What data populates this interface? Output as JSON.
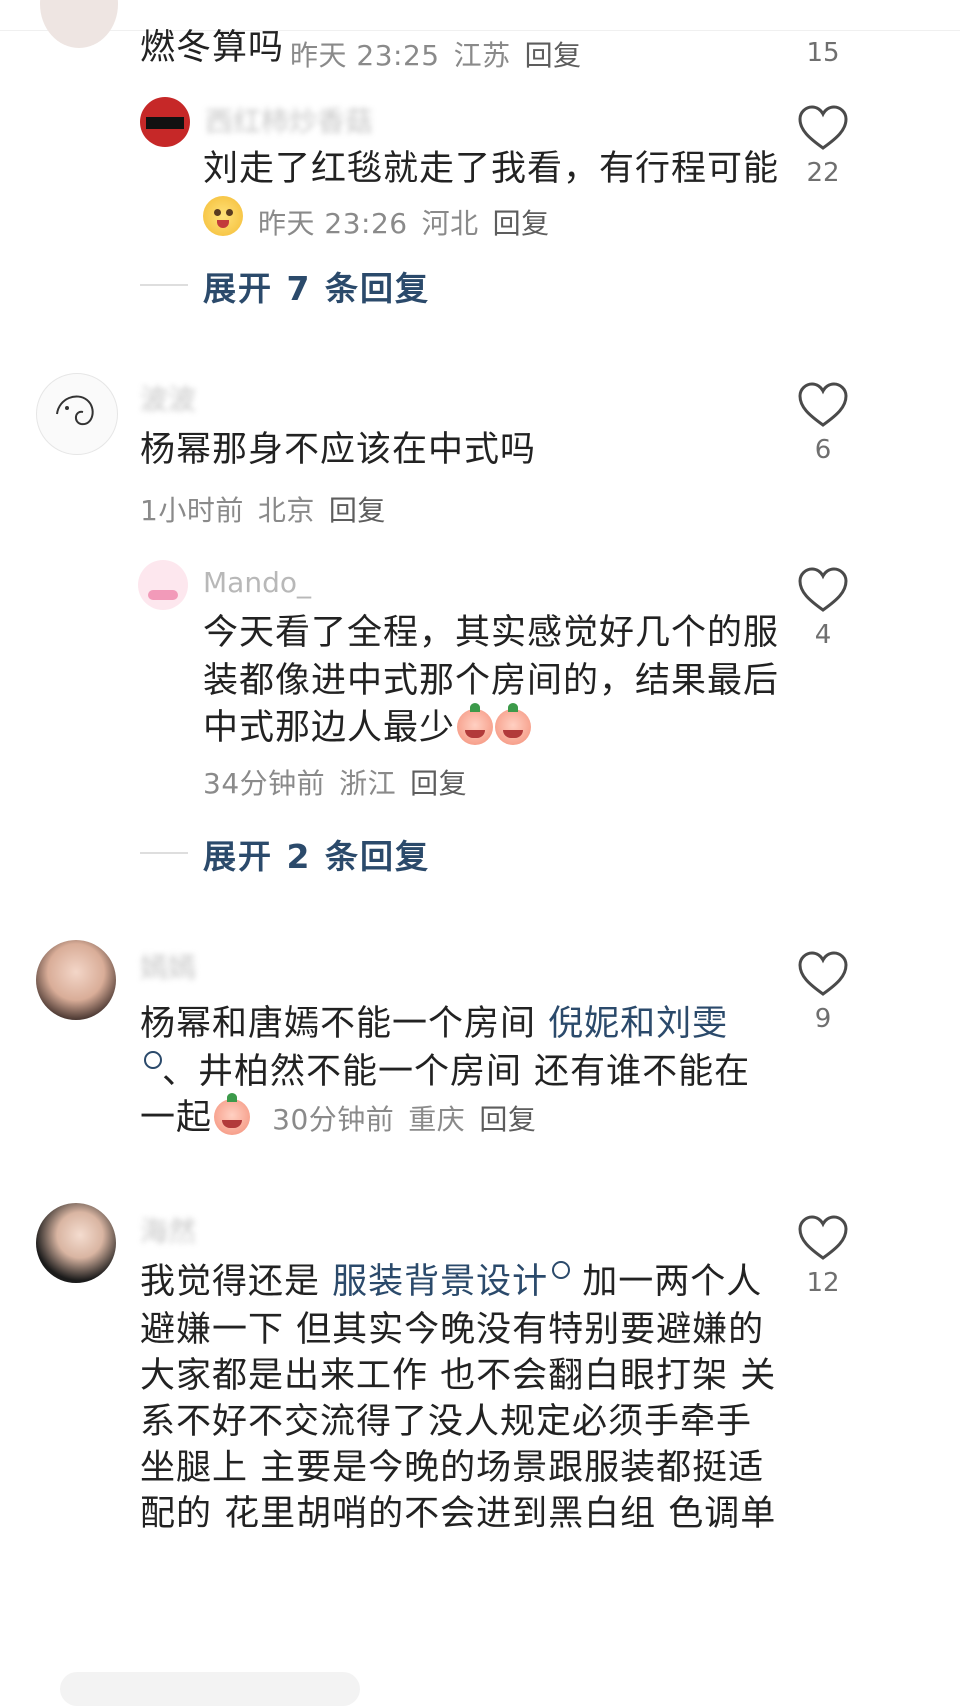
{
  "comments": [
    {
      "text": "燃冬算吗",
      "time": "昨天 23:25",
      "location": "江苏",
      "reply": "回复",
      "likes": "15"
    },
    {
      "name": "西红柿炒香菇",
      "text": "刘走了红毯就走了我看，有行程可能",
      "time": "昨天 23:26",
      "location": "河北",
      "reply": "回复",
      "likes": "22",
      "expand": "展开 7 条回复"
    },
    {
      "name": "波波",
      "text": "杨幂那身不应该在中式吗",
      "time": "1小时前",
      "location": "北京",
      "reply": "回复",
      "likes": "6"
    },
    {
      "name": "Mando_",
      "text_lines": [
        "今天看了全程，其实感觉好几个的服",
        "装都像进中式那个房间的，结果最后",
        "中式那边人最少"
      ],
      "time": "34分钟前",
      "location": "浙江",
      "reply": "回复",
      "likes": "4",
      "expand": "展开 2 条回复"
    },
    {
      "name": "嫣嫣",
      "text_part1": "杨幂和唐嫣不能一个房间 ",
      "link1": "倪妮和刘雯",
      "text_part2": "、井柏然不能一个房间 还有谁不能在",
      "text_part3": "一起",
      "time": "30分钟前",
      "location": "重庆",
      "reply": "回复",
      "likes": "9"
    },
    {
      "name": "海然",
      "text_prefix": "我觉得还是 ",
      "link": "服装背景设计",
      "text_suffix": " 加一两个人",
      "text_lines": [
        "避嫌一下 但其实今晚没有特别要避嫌的",
        "大家都是出来工作 也不会翻白眼打架 关",
        "系不好不交流得了没人规定必须手牵手",
        "坐腿上 主要是今晚的场景跟服装都挺适",
        "配的 花里胡哨的不会进到黑白组 色调单"
      ],
      "likes": "12"
    }
  ],
  "icons": {
    "like": "heart-outline-icon",
    "search": "search-icon"
  },
  "colors": {
    "link": "#2b4a6b",
    "meta": "#8a8a8a",
    "text": "#222222"
  }
}
